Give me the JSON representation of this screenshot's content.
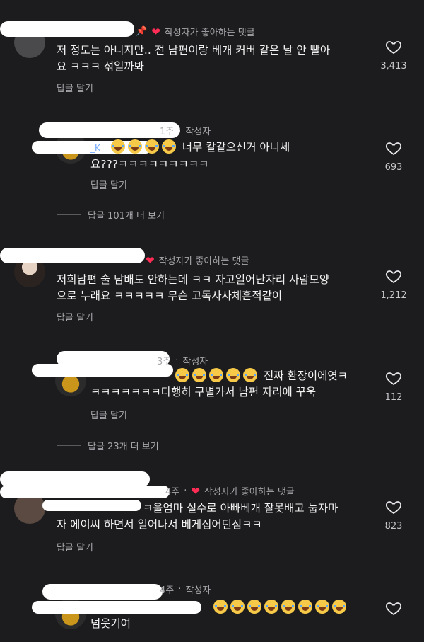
{
  "labels": {
    "reply": "답글 달기",
    "author": "작성자",
    "liked_by_author": "작성자가 좋아하는 댓글"
  },
  "comments": [
    {
      "meta_text": "작성자가 좋아하는 댓글",
      "pinned": true,
      "text_lines": [
        "저 정도는 아니지만.. 전 남편이랑 베개 커버 같은 날 안 빨아",
        "요 ㅋㅋㅋ 섞일까봐"
      ],
      "likes": "3,413",
      "reply_label": "답글 달기"
    },
    {
      "username_fragment": "_K",
      "meta_text": "작성자",
      "age": "1주",
      "text_lines": [
        "너무 칼같으신거 아니세",
        "요???ㅋㅋㅋㅋㅋㅋㅋㅋㅋ"
      ],
      "emoji_count": 4,
      "likes": "693",
      "reply_label": "답글 달기",
      "more_replies": "답글 101개 더 보기"
    },
    {
      "meta_text": "작성자가 좋아하는 댓글",
      "text_lines": [
        "저희남편 술 담배도 안하는데 ㅋㅋ 자고일어난자리 사람모양",
        "으로 누래요 ㅋㅋㅋㅋㅋ  무슨 고독사사체흔적같이"
      ],
      "likes": "1,212",
      "reply_label": "답글 달기"
    },
    {
      "meta_text": "작성자",
      "age": "3주",
      "text_lines": [
        "진짜 환장이에엿ㅋ",
        "ㅋㅋㅋㅋㅋㅋㅋ다행히 구별가서 남편 자리에 꾸욱"
      ],
      "emoji_count": 5,
      "likes": "112",
      "reply_label": "답글 달기",
      "more_replies": "답글 23개 더 보기"
    },
    {
      "meta_text": "작성자가 좋아하는 댓글",
      "age": "4주",
      "text_lines": [
        "ㅋ울엄마 실수로 아빠베개 잘못배고 눕자마",
        "자 에이씨 하면서 일어나서 베게집어던짐ㅋㅋ"
      ],
      "likes": "823",
      "reply_label": "답글 달기"
    },
    {
      "meta_text": "작성자",
      "age": "4주",
      "text_lines": [
        "넘웃겨여"
      ],
      "emoji_count": 8,
      "likes": "",
      "reply_label": ""
    }
  ]
}
